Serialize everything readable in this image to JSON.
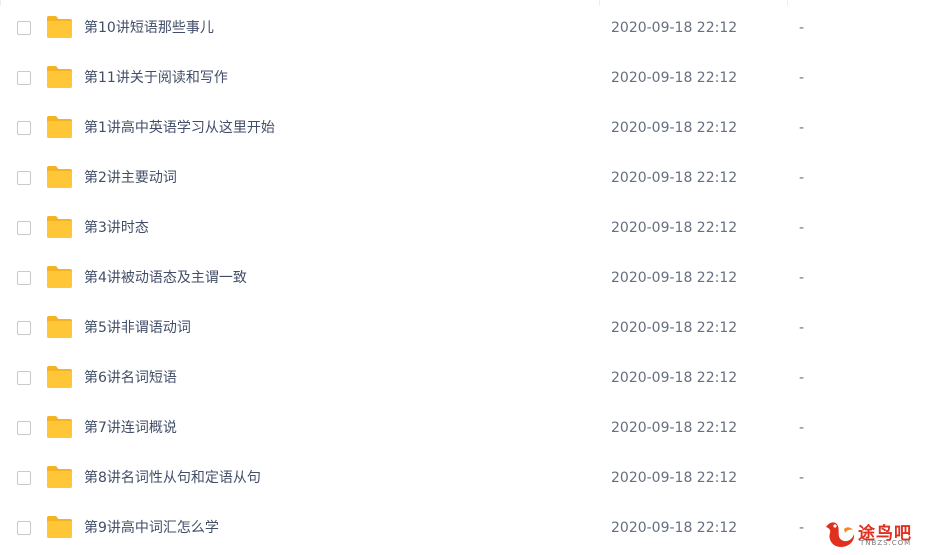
{
  "files": [
    {
      "name": "第10讲短语那些事儿",
      "date": "2020-09-18 22:12",
      "size": "-"
    },
    {
      "name": "第11讲关于阅读和写作",
      "date": "2020-09-18 22:12",
      "size": "-"
    },
    {
      "name": "第1讲高中英语学习从这里开始",
      "date": "2020-09-18 22:12",
      "size": "-"
    },
    {
      "name": "第2讲主要动词",
      "date": "2020-09-18 22:12",
      "size": "-"
    },
    {
      "name": "第3讲时态",
      "date": "2020-09-18 22:12",
      "size": "-"
    },
    {
      "name": "第4讲被动语态及主谓一致",
      "date": "2020-09-18 22:12",
      "size": "-"
    },
    {
      "name": "第5讲非谓语动词",
      "date": "2020-09-18 22:12",
      "size": "-"
    },
    {
      "name": "第6讲名词短语",
      "date": "2020-09-18 22:12",
      "size": "-"
    },
    {
      "name": "第7讲连词概说",
      "date": "2020-09-18 22:12",
      "size": "-"
    },
    {
      "name": "第8讲名词性从句和定语从句",
      "date": "2020-09-18 22:12",
      "size": "-"
    },
    {
      "name": "第9讲高中词汇怎么学",
      "date": "2020-09-18 22:12",
      "size": "-"
    }
  ],
  "watermark": {
    "text": "途鸟吧",
    "subtext": "TNBZS.COM"
  },
  "colors": {
    "folder": "#ffc637",
    "folder_back": "#f5b324",
    "text": "#424e67",
    "meta": "#666f80",
    "watermark": "#e0301e"
  }
}
